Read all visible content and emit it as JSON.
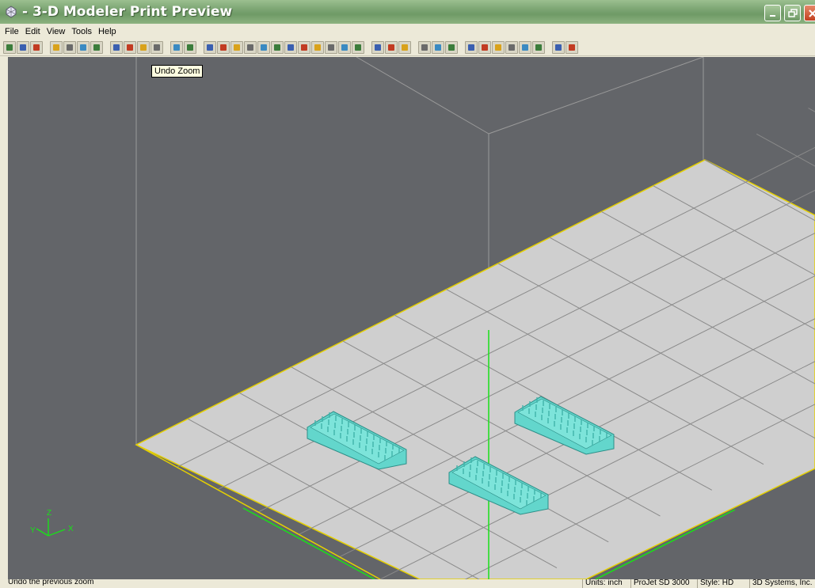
{
  "window": {
    "title": " - 3-D Modeler Print Preview",
    "controls": {
      "minimize": "minimize-button",
      "maximize": "maximize-button",
      "close": "close-button"
    }
  },
  "menu": [
    "File",
    "Edit",
    "View",
    "Tools",
    "Help"
  ],
  "toolbar": {
    "icons": [
      "open-icon",
      "save-icon",
      "select-icon",
      "rotate-icon",
      "print-icon",
      "settings-icon",
      "arrange-icon",
      "group-icon",
      "zoom-in-icon",
      "undo-zoom-icon",
      "stop-icon",
      "build-icon",
      "view-front-icon",
      "view-back-icon",
      "view-iso-icon",
      "move-icon",
      "view-left-icon",
      "view-right-icon",
      "view-top-icon",
      "view-bottom-icon",
      "view-icon-a",
      "view-icon-b",
      "view-icon-c",
      "view-icon-d",
      "fit-icon",
      "grid-icon",
      "copy-icon",
      "paste-icon",
      "measure-icon",
      "slice-icon",
      "edit-icon",
      "tool-icon",
      "tool-icon-b",
      "tool-icon-c",
      "tool-icon-d",
      "color-icon",
      "material-icon",
      "options-icon",
      "exit-icon"
    ],
    "accent": "#1a5fcc"
  },
  "tooltip": {
    "text": "Undo Zoom"
  },
  "viewport": {
    "background": "#636569",
    "plate_color": "#cfcfcf",
    "plate_border": "#e5d000",
    "part_color": "#63d6cc",
    "axis_color": "#19e019",
    "axes": {
      "z": "Z",
      "y": "Y",
      "x": "X"
    }
  },
  "statusbar": {
    "message": "Undo the previous zoom",
    "panes": [
      "Units: inch",
      "ProJet SD 3000",
      "Style: HD",
      "3D Systems, Inc."
    ]
  }
}
